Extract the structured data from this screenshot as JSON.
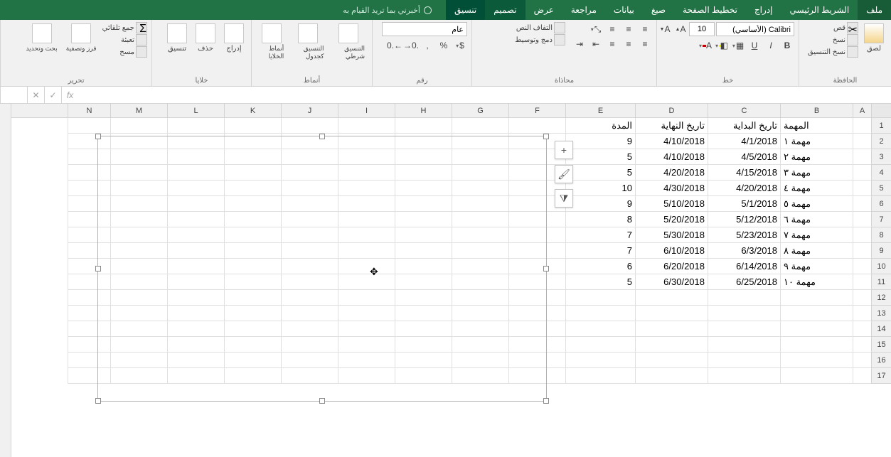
{
  "tabs": {
    "file": "ملف",
    "home": "الشريط الرئيسي",
    "insert": "إدراج",
    "layout": "تخطيط الصفحة",
    "formulas": "صيغ",
    "data": "بيانات",
    "review": "مراجعة",
    "view": "عرض",
    "design": "تصميم",
    "format": "تنسيق"
  },
  "tell_me": "أخبرني بما تريد القيام به",
  "ribbon": {
    "clipboard": {
      "label": "الحافظة",
      "paste": "لصق",
      "cut": "قص",
      "copy": "نسخ",
      "format_painter": "نسخ التنسيق"
    },
    "font": {
      "label": "خط",
      "name": "Calibri (الأساسي)",
      "size": "10"
    },
    "alignment": {
      "label": "محاذاة",
      "wrap": "التفاف النص",
      "merge": "دمج وتوسيط"
    },
    "number": {
      "label": "رقم",
      "general": "عام"
    },
    "styles": {
      "label": "أنماط",
      "cond": "التنسيق شرطي",
      "table": "التنسيق كجدول",
      "cell": "أنماط الخلايا"
    },
    "cells": {
      "label": "خلايا",
      "insert": "إدراج",
      "delete": "حذف",
      "format": "تنسيق"
    },
    "editing": {
      "label": "تحرير",
      "sum": "جمع تلقائي",
      "fill": "تعبئة",
      "clear": "مسح",
      "sort": "فرز وتصفية",
      "find": "بحث وتحديد"
    }
  },
  "formula_bar": {
    "name_box": "",
    "fx": "fx"
  },
  "columns": [
    "A",
    "B",
    "C",
    "D",
    "E",
    "F",
    "G",
    "H",
    "I",
    "J",
    "K",
    "L",
    "M",
    "N"
  ],
  "headers": {
    "task": "المهمة",
    "start": "تاريخ البداية",
    "end": "تاريخ النهاية",
    "duration": "المدة"
  },
  "rows": [
    {
      "task": "مهمة ١",
      "start": "4/1/2018",
      "end": "4/10/2018",
      "dur": "9"
    },
    {
      "task": "مهمة ٢",
      "start": "4/5/2018",
      "end": "4/10/2018",
      "dur": "5"
    },
    {
      "task": "مهمة ٣",
      "start": "4/15/2018",
      "end": "4/20/2018",
      "dur": "5"
    },
    {
      "task": "مهمة ٤",
      "start": "4/20/2018",
      "end": "4/30/2018",
      "dur": "10"
    },
    {
      "task": "مهمة ٥",
      "start": "5/1/2018",
      "end": "5/10/2018",
      "dur": "9"
    },
    {
      "task": "مهمة ٦",
      "start": "5/12/2018",
      "end": "5/20/2018",
      "dur": "8"
    },
    {
      "task": "مهمة ٧",
      "start": "5/23/2018",
      "end": "5/30/2018",
      "dur": "7"
    },
    {
      "task": "مهمة ٨",
      "start": "6/3/2018",
      "end": "6/10/2018",
      "dur": "7"
    },
    {
      "task": "مهمة ٩",
      "start": "6/14/2018",
      "end": "6/20/2018",
      "dur": "6"
    },
    {
      "task": "مهمة ١٠",
      "start": "6/25/2018",
      "end": "6/30/2018",
      "dur": "5"
    }
  ],
  "chart_side": {
    "plus": "+",
    "brush": "🖌",
    "filter": "⧩"
  }
}
